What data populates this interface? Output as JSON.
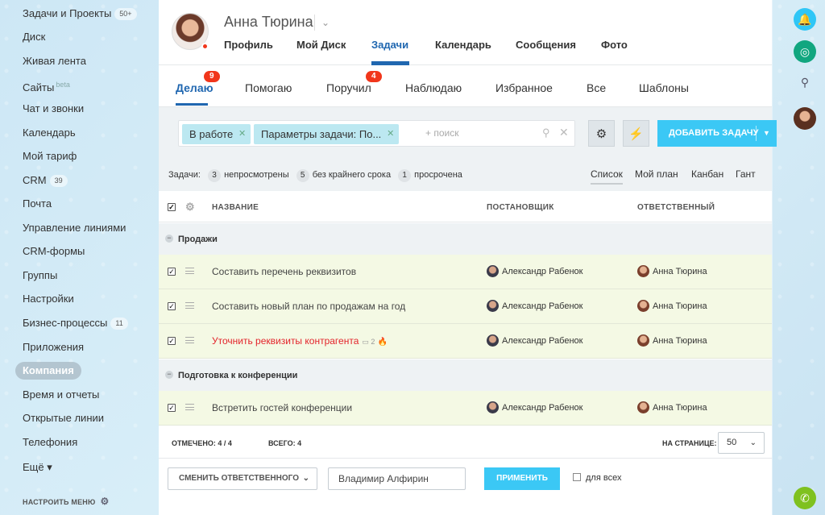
{
  "sidebar": {
    "items": [
      {
        "label": "Задачи и Проекты",
        "counter": "50+"
      },
      {
        "label": "Диск"
      },
      {
        "label": "Живая лента"
      },
      {
        "label": "Сайты",
        "sup": "beta"
      },
      {
        "label": "Чат и звонки"
      },
      {
        "label": "Календарь"
      },
      {
        "label": "Мой тариф"
      },
      {
        "label": "CRM",
        "counter": "39"
      },
      {
        "label": "Почта"
      },
      {
        "label": "Управление линиями"
      },
      {
        "label": "CRM-формы"
      },
      {
        "label": "Группы"
      },
      {
        "label": "Настройки"
      },
      {
        "label": "Бизнес-процессы",
        "counter": "11"
      },
      {
        "label": "Приложения"
      },
      {
        "label": "Компания"
      },
      {
        "label": "Время и отчеты"
      },
      {
        "label": "Открытые линии"
      },
      {
        "label": "Телефония"
      },
      {
        "label": "Ещё ▾"
      }
    ],
    "settings_label": "НАСТРОИТЬ МЕНЮ"
  },
  "profile": {
    "name": "Анна Тюрина",
    "tabs": [
      "Профиль",
      "Мой Диск",
      "Задачи",
      "Календарь",
      "Сообщения",
      "Фото"
    ]
  },
  "subtabs": {
    "items": [
      "Делаю",
      "Помогаю",
      "Поручил",
      "Наблюдаю",
      "Избранное",
      "Все",
      "Шаблоны"
    ],
    "badge_doing": "9",
    "badge_assigned": "4"
  },
  "filter": {
    "chip1": "В работе",
    "chip2": "Параметры задачи: По...",
    "search_placeholder": "+ поиск",
    "add_button": "ДОБАВИТЬ ЗАДАЧУ"
  },
  "counters": {
    "prefix": "Задачи:",
    "unviewed_count": "3",
    "unviewed_label": "непросмотрены",
    "nodeadline_count": "5",
    "nodeadline_label": "без крайнего срока",
    "overdue_count": "1",
    "overdue_label": "просрочена"
  },
  "views": [
    "Список",
    "Мой план",
    "Канбан",
    "Гант"
  ],
  "table": {
    "headers": {
      "name": "НАЗВАНИЕ",
      "creator": "ПОСТАНОВЩИК",
      "responsible": "ОТВЕТСТВЕННЫЙ"
    },
    "groups": [
      {
        "title": "Продажи"
      },
      {
        "title": "Подготовка к конференции"
      }
    ],
    "rows": [
      {
        "title": "Составить перечень реквизитов",
        "creator": "Александр Рабенок",
        "responsible": "Анна Тюрина"
      },
      {
        "title": "Составить новый план по продажам на год",
        "creator": "Александр Рабенок",
        "responsible": "Анна Тюрина"
      },
      {
        "title": "Уточнить реквизиты контрагента",
        "comments": "2",
        "creator": "Александр Рабенок",
        "responsible": "Анна Тюрина"
      },
      {
        "title": "Встретить гостей конференции",
        "creator": "Александр Рабенок",
        "responsible": "Анна Тюрина"
      }
    ]
  },
  "footer": {
    "marked_label": "ОТМЕЧЕНО:",
    "marked_value": "4 / 4",
    "total_label": "ВСЕГО:",
    "total_value": "4",
    "perpage_label": "НА СТРАНИЦЕ:",
    "perpage_value": "50"
  },
  "actions": {
    "select_label": "СМЕНИТЬ ОТВЕТСТВЕННОГО",
    "input_value": "Владимир Алфирин",
    "apply_label": "ПРИМЕНИТЬ",
    "for_all_label": "для всех"
  },
  "colors": {
    "accent": "#2067b0",
    "button": "#3bc8f5",
    "badge": "#f1361b",
    "row_bg": "#f4f9e4"
  }
}
